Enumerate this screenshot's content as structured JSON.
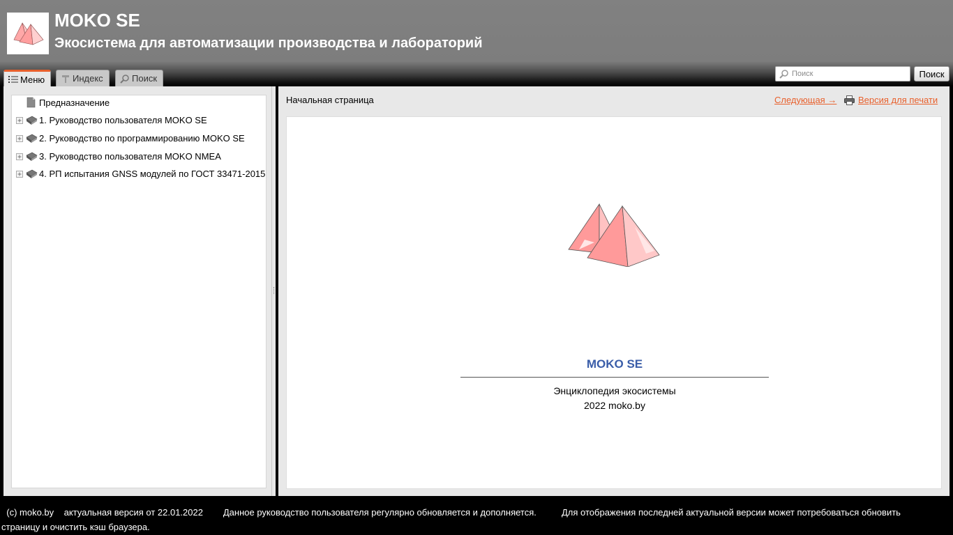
{
  "header": {
    "title": "MOKO SE",
    "subtitle": "Экосистема для автоматизации производства и лабораторий"
  },
  "tabs": [
    {
      "label": "Меню",
      "icon": "list-icon",
      "active": true
    },
    {
      "label": "Индекс",
      "icon": "pushpin-icon",
      "active": false
    },
    {
      "label": "Поиск",
      "icon": "magnifier-icon",
      "active": false
    }
  ],
  "search": {
    "placeholder": "Поиск",
    "button_label": "Поиск"
  },
  "tree": {
    "items": [
      {
        "label": "Предназначение",
        "icon": "page-icon",
        "expandable": false
      },
      {
        "label": "1. Руководство пользователя MOKO SE",
        "icon": "book-icon",
        "expandable": true
      },
      {
        "label": "2. Руководство по программированию MOKO SE",
        "icon": "book-icon",
        "expandable": true
      },
      {
        "label": "3. Руководство пользователя MOKO NMEA",
        "icon": "book-icon",
        "expandable": true
      },
      {
        "label": "4. РП испытания GNSS модулей по ГОСТ 33471-2015",
        "icon": "book-icon",
        "expandable": true
      }
    ]
  },
  "content": {
    "breadcrumb": "Начальная страница",
    "next_label": "Следующая →",
    "print_label": "Версия для печати",
    "title": "MOKO SE",
    "line1": "Энциклопедия экосистемы",
    "line2": "2022 moko.by"
  },
  "footer": {
    "copyright": "(c) moko.by",
    "version": "актуальная версия от 22.01.2022",
    "note1": "Данное руководство пользователя регулярно обновляется и дополняется.",
    "note2": "Для отображения последней актуальной версии может потребоваться обновить страницу и очистить кэш браузера."
  },
  "colors": {
    "accent": "#e8602c",
    "title_blue": "#3a5da8",
    "pyramid": "#ff9e9e"
  }
}
